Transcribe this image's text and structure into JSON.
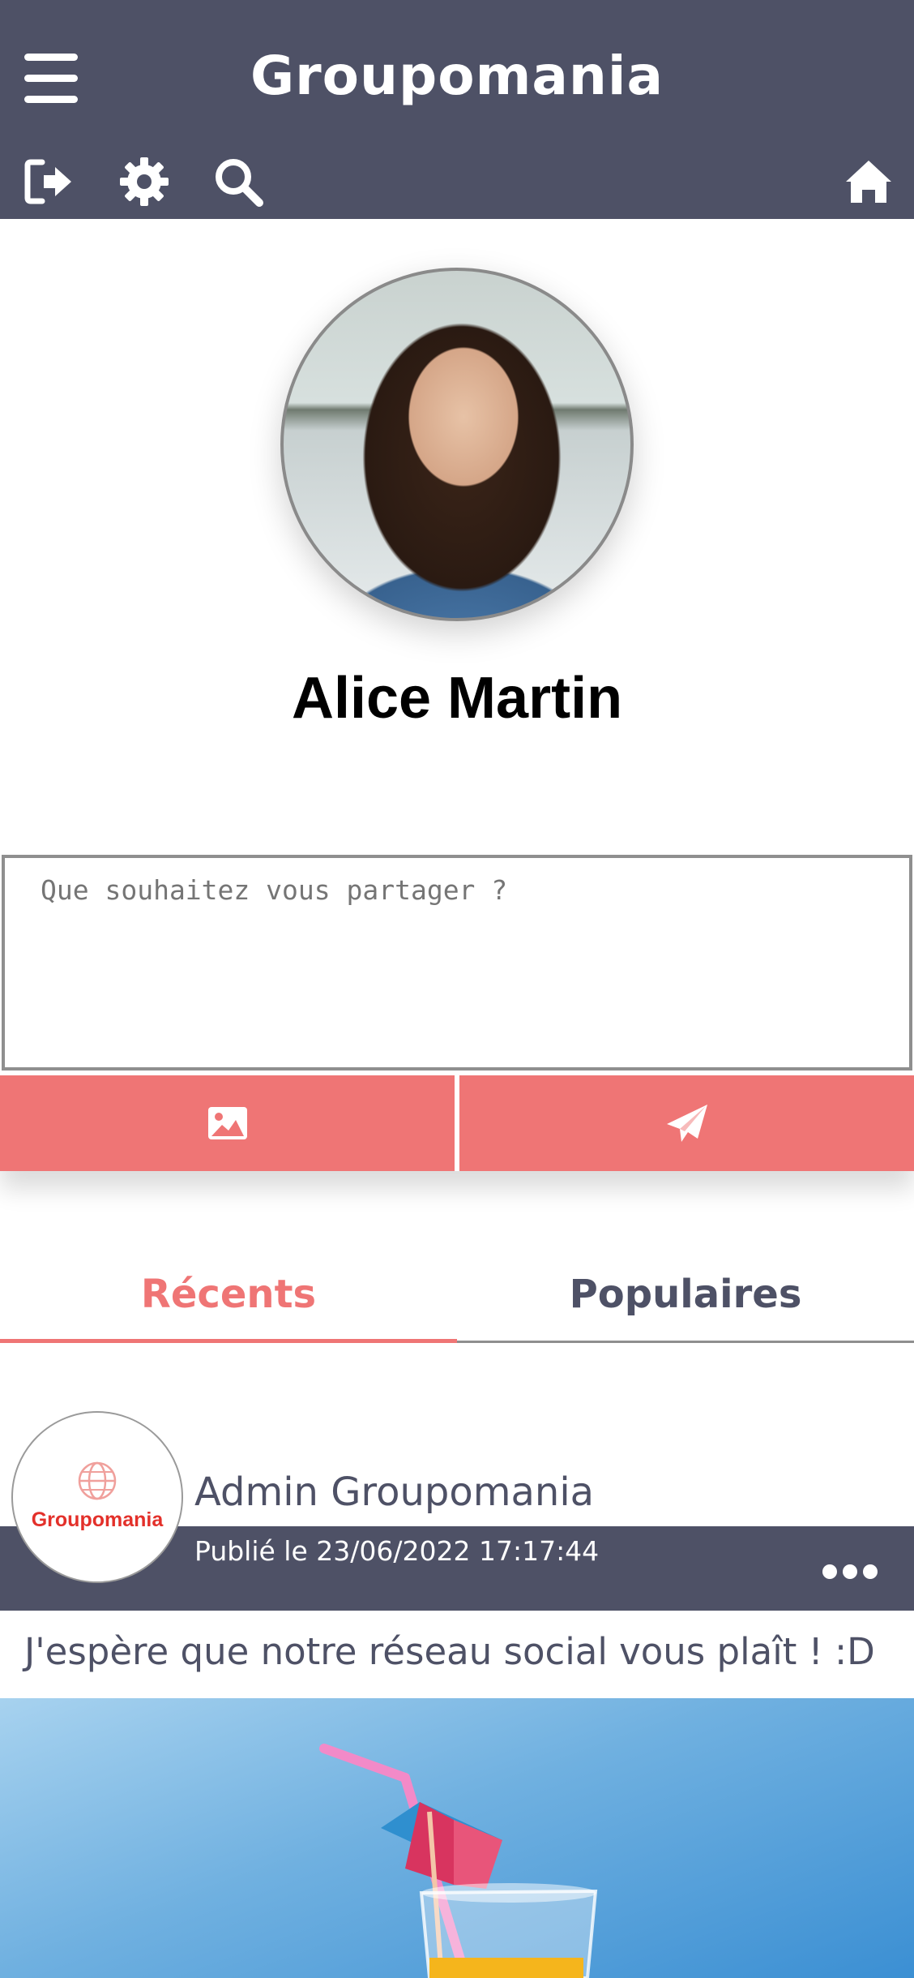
{
  "header": {
    "title": "Groupomania",
    "menu_icon": "hamburger-menu-icon",
    "icons": [
      "logout-icon",
      "gear-icon",
      "search-icon",
      "home-icon"
    ]
  },
  "profile": {
    "name": "Alice Martin"
  },
  "composer": {
    "placeholder": "Que souhaitez vous partager ?",
    "image_button_icon": "image-icon",
    "send_button_icon": "paper-plane-icon"
  },
  "tabs": [
    {
      "label": "Récents",
      "active": true
    },
    {
      "label": "Populaires",
      "active": false
    }
  ],
  "post": {
    "author": "Admin Groupomania",
    "avatar_brand": "Groupomania",
    "date": "Publié le 23/06/2022 17:17:44",
    "text": "J'espère que notre réseau social vous plaît ! :D",
    "more_icon": "ellipsis-icon"
  },
  "colors": {
    "primary_dark": "#4e5166",
    "accent": "#ef7575",
    "brand_red": "#e3302a"
  }
}
